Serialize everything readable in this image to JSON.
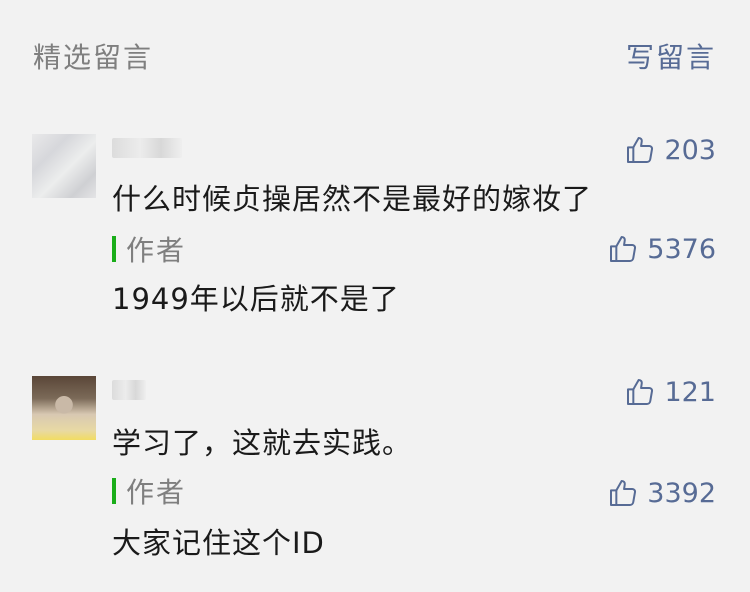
{
  "header": {
    "title": "精选留言",
    "write_label": "写留言"
  },
  "comments": [
    {
      "likes": "203",
      "text": "什么时候贞操居然不是最好的嫁妆了",
      "reply": {
        "label": "作者",
        "likes": "5376",
        "text": "1949年以后就不是了"
      }
    },
    {
      "likes": "121",
      "text": "学习了，这就去实践。",
      "reply": {
        "label": "作者",
        "likes": "3392",
        "text": "大家记住这个ID"
      }
    }
  ],
  "colors": {
    "link": "#576b95",
    "author_bar": "#1aad19",
    "muted": "#7f7f7f"
  },
  "icons": {
    "like": "thumbs-up-icon"
  }
}
